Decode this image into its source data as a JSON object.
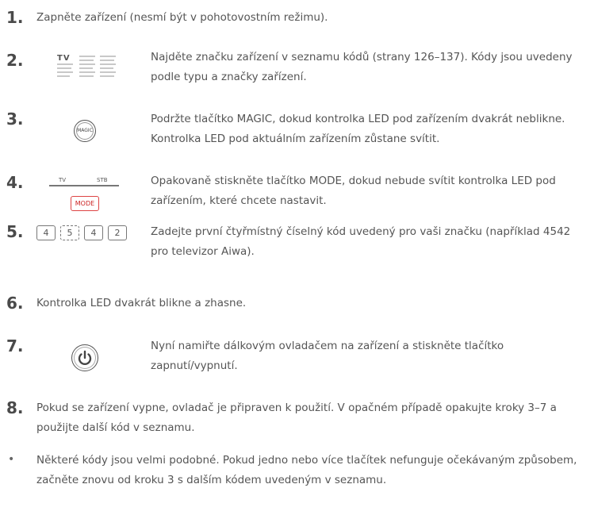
{
  "steps": {
    "s1": {
      "num": "1.",
      "text": "Zapněte zařízení (nesmí být v pohotovostním režimu)."
    },
    "s2": {
      "num": "2.",
      "text": "Najděte značku zařízení v seznamu kódů (strany 126–137). Kódy jsou uvedeny podle typu a značky zařízení.",
      "thumb_label": "TV"
    },
    "s3": {
      "num": "3.",
      "text": "Podržte tlačítko MAGIC, dokud kontrolka LED pod zařízením dvakrát neblikne. Kontrolka LED pod aktuálním zařízením zůstane svítit.",
      "button_label": "MAGIC"
    },
    "s4": {
      "num": "4.",
      "text": "Opakovaně stiskněte tlačítko MODE, dokud nebude svítit kontrolka LED pod zařízením, které chcete nastavit.",
      "tv_label": "TV",
      "stb_label": "STB",
      "mode_label": "MODE"
    },
    "s5": {
      "num": "5.",
      "text": "Zadejte první čtyřmístný číselný kód uvedený pro vaši značku (například 4542 pro televizor Aiwa).",
      "keys": [
        "4",
        "5",
        "4",
        "2"
      ]
    },
    "s6": {
      "num": "6.",
      "text": "Kontrolka LED dvakrát blikne a zhasne."
    },
    "s7": {
      "num": "7.",
      "text": "Nyní namiřte dálkovým ovladačem na zařízení a stiskněte tlačítko zapnutí/vypnutí."
    },
    "s8": {
      "num": "8.",
      "text": "Pokud se zařízení vypne, ovladač je připraven k použití. V opačném případě opakujte kroky 3–7 a použijte další kód v seznamu."
    },
    "note": {
      "bullet": "•",
      "text": "Některé kódy jsou velmi podobné. Pokud jedno nebo více tlačítek nefunguje očekávaným způsobem, začněte znovu od kroku 3 s dalším kódem uvedeným v seznamu."
    }
  }
}
